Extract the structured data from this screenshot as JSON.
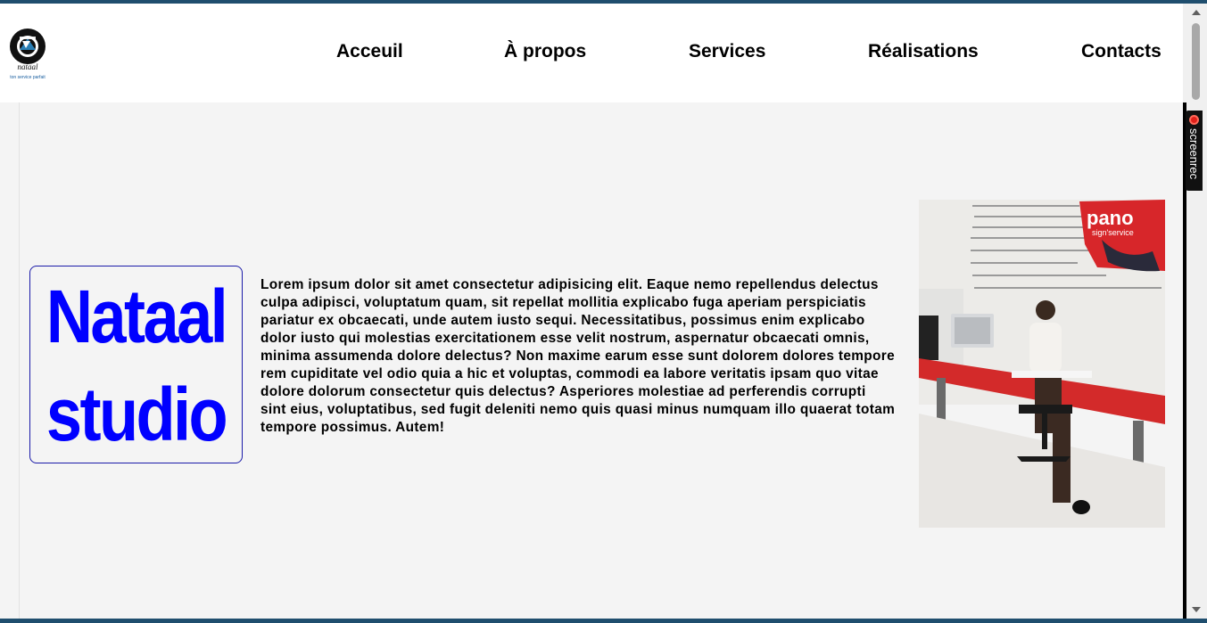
{
  "header": {
    "logo_icon": "camera-lens-logo",
    "logo_text": "nataal",
    "logo_tagline": "ton service parfait",
    "nav": [
      {
        "label": "Acceuil"
      },
      {
        "label": "À propos"
      },
      {
        "label": "Services"
      },
      {
        "label": "Réalisations"
      },
      {
        "label": "Contacts"
      }
    ]
  },
  "main": {
    "brand_line1": "Nataal",
    "brand_line2": "studio",
    "brand_color": "#0000ff",
    "body_text": "Lorem ipsum dolor sit amet consectetur adipisicing elit. Eaque nemo repellendus delectus culpa adipisci, voluptatum quam, sit repellat mollitia explicabo fuga aperiam perspiciatis pariatur ex obcaecati, unde autem iusto sequi. Necessitatibus, possimus enim explicabo dolor iusto qui molestias exercitationem esse velit nostrum, aspernatur obcaecati omnis, minima assumenda dolore delectus? Non maxime earum esse sunt dolorem dolores tempore rem cupiditate vel odio quia a hic et voluptas, commodi ea labore veritatis ipsam quo vitae dolore dolorum consectetur quis delectus? Asperiores molestiae ad perferendis corrupti sint eius, voluptatibus, sed fugit deleniti nemo quis quasi minus numquam illo quaerat totam tempore possimus. Autem!",
    "photo_sign": "pano",
    "photo_sign_sub": "sign'service"
  },
  "overlay": {
    "screenrec_label": "screenrec",
    "record_icon": "record-dot-icon"
  }
}
